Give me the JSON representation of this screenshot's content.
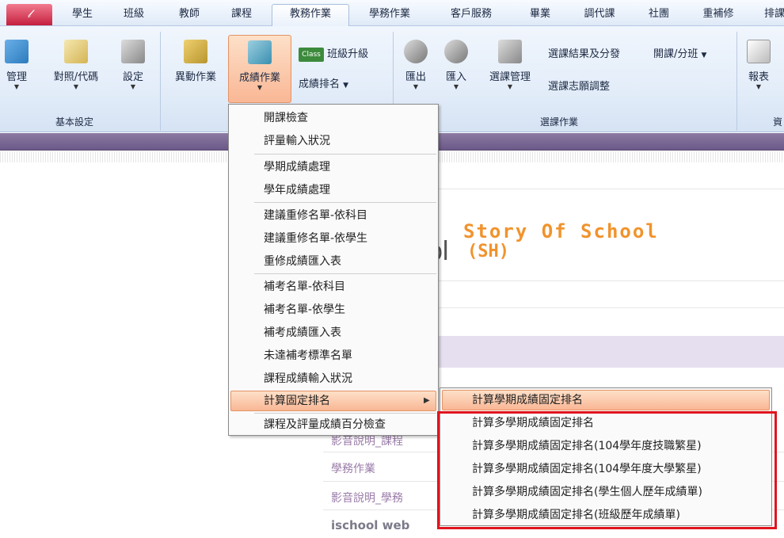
{
  "tabs": [
    "學生",
    "班級",
    "教師",
    "課程",
    "教務作業",
    "學務作業",
    "客戶服務",
    "畢業",
    "調代課",
    "社團",
    "重補修",
    "排課"
  ],
  "active_tab": "教務作業",
  "ribbon": {
    "basic": {
      "label": "基本設定",
      "items": [
        "管理",
        "對照/代碼",
        "設定"
      ]
    },
    "grade": {
      "items": [
        "異動作業",
        "成績作業"
      ],
      "small": [
        "班級升級",
        "成績排名"
      ]
    },
    "course": {
      "label": "選課作業",
      "items": [
        "匯出",
        "匯入",
        "選課管理"
      ],
      "small": [
        "選課結果及分發",
        "開課/分班",
        "選課志願調整"
      ]
    },
    "report": {
      "items": [
        "報表"
      ],
      "label_partial": "資"
    }
  },
  "menu": {
    "items": [
      "開課檢查",
      "評量輸入狀況",
      "學期成績處理",
      "學年成績處理",
      "建議重修名單-依科目",
      "建議重修名單-依學生",
      "重修成績匯入表",
      "補考名單-依科目",
      "補考名單-依學生",
      "補考成績匯入表",
      "未達補考標準名單",
      "課程成績輸入狀況",
      "計算固定排名",
      "課程及評量成績百分檢查"
    ]
  },
  "submenu": {
    "items": [
      "計算學期成績固定排名",
      "計算多學期成績固定排名",
      "計算多學期成績固定排名(104學年度技職繁星)",
      "計算多學期成績固定排名(104學年度大學繁星)",
      "計算多學期成績固定排名(學生個人歷年成績單)",
      "計算多學期成績固定排名(班級歷年成績單)"
    ]
  },
  "content": {
    "brand_partial": "ol",
    "story": "Story Of School",
    "sh": "(SH)",
    "links": [
      "影音說明_課程",
      "學務作業",
      "影音說明_學務"
    ],
    "ischool": "ischool web"
  }
}
